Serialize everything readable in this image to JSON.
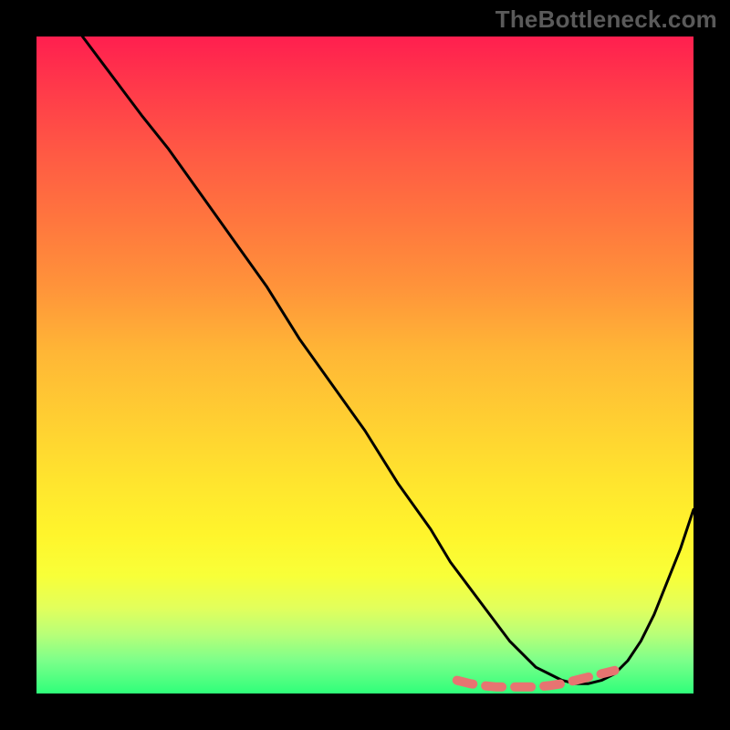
{
  "watermark": "TheBottleneck.com",
  "chart_data": {
    "type": "line",
    "title": "",
    "xlabel": "",
    "ylabel": "",
    "xlim": [
      0,
      100
    ],
    "ylim": [
      0,
      100
    ],
    "series": [
      {
        "name": "main-curve",
        "x": [
          7,
          10,
          13,
          16,
          20,
          25,
          30,
          35,
          40,
          45,
          50,
          55,
          60,
          63,
          66,
          69,
          72,
          74,
          76,
          78,
          80,
          82,
          84,
          86,
          88,
          90,
          92,
          94,
          96,
          98,
          100
        ],
        "y": [
          100,
          96,
          92,
          88,
          83,
          76,
          69,
          62,
          54,
          47,
          40,
          32,
          25,
          20,
          16,
          12,
          8,
          6,
          4,
          3,
          2,
          1.5,
          1.5,
          2,
          3,
          5,
          8,
          12,
          17,
          22,
          28
        ]
      },
      {
        "name": "highlight-segment",
        "x": [
          64,
          66,
          68,
          70,
          72,
          74,
          76,
          78,
          80,
          82,
          84,
          86,
          88
        ],
        "y": [
          2,
          1.5,
          1.2,
          1.0,
          1.0,
          1.0,
          1.0,
          1.2,
          1.5,
          2,
          2.5,
          3,
          3.5
        ]
      }
    ],
    "colors": {
      "curve": "#000000",
      "highlight": "#e77471",
      "gradient_top": "#ff1f4f",
      "gradient_bottom": "#2fff7a"
    }
  }
}
